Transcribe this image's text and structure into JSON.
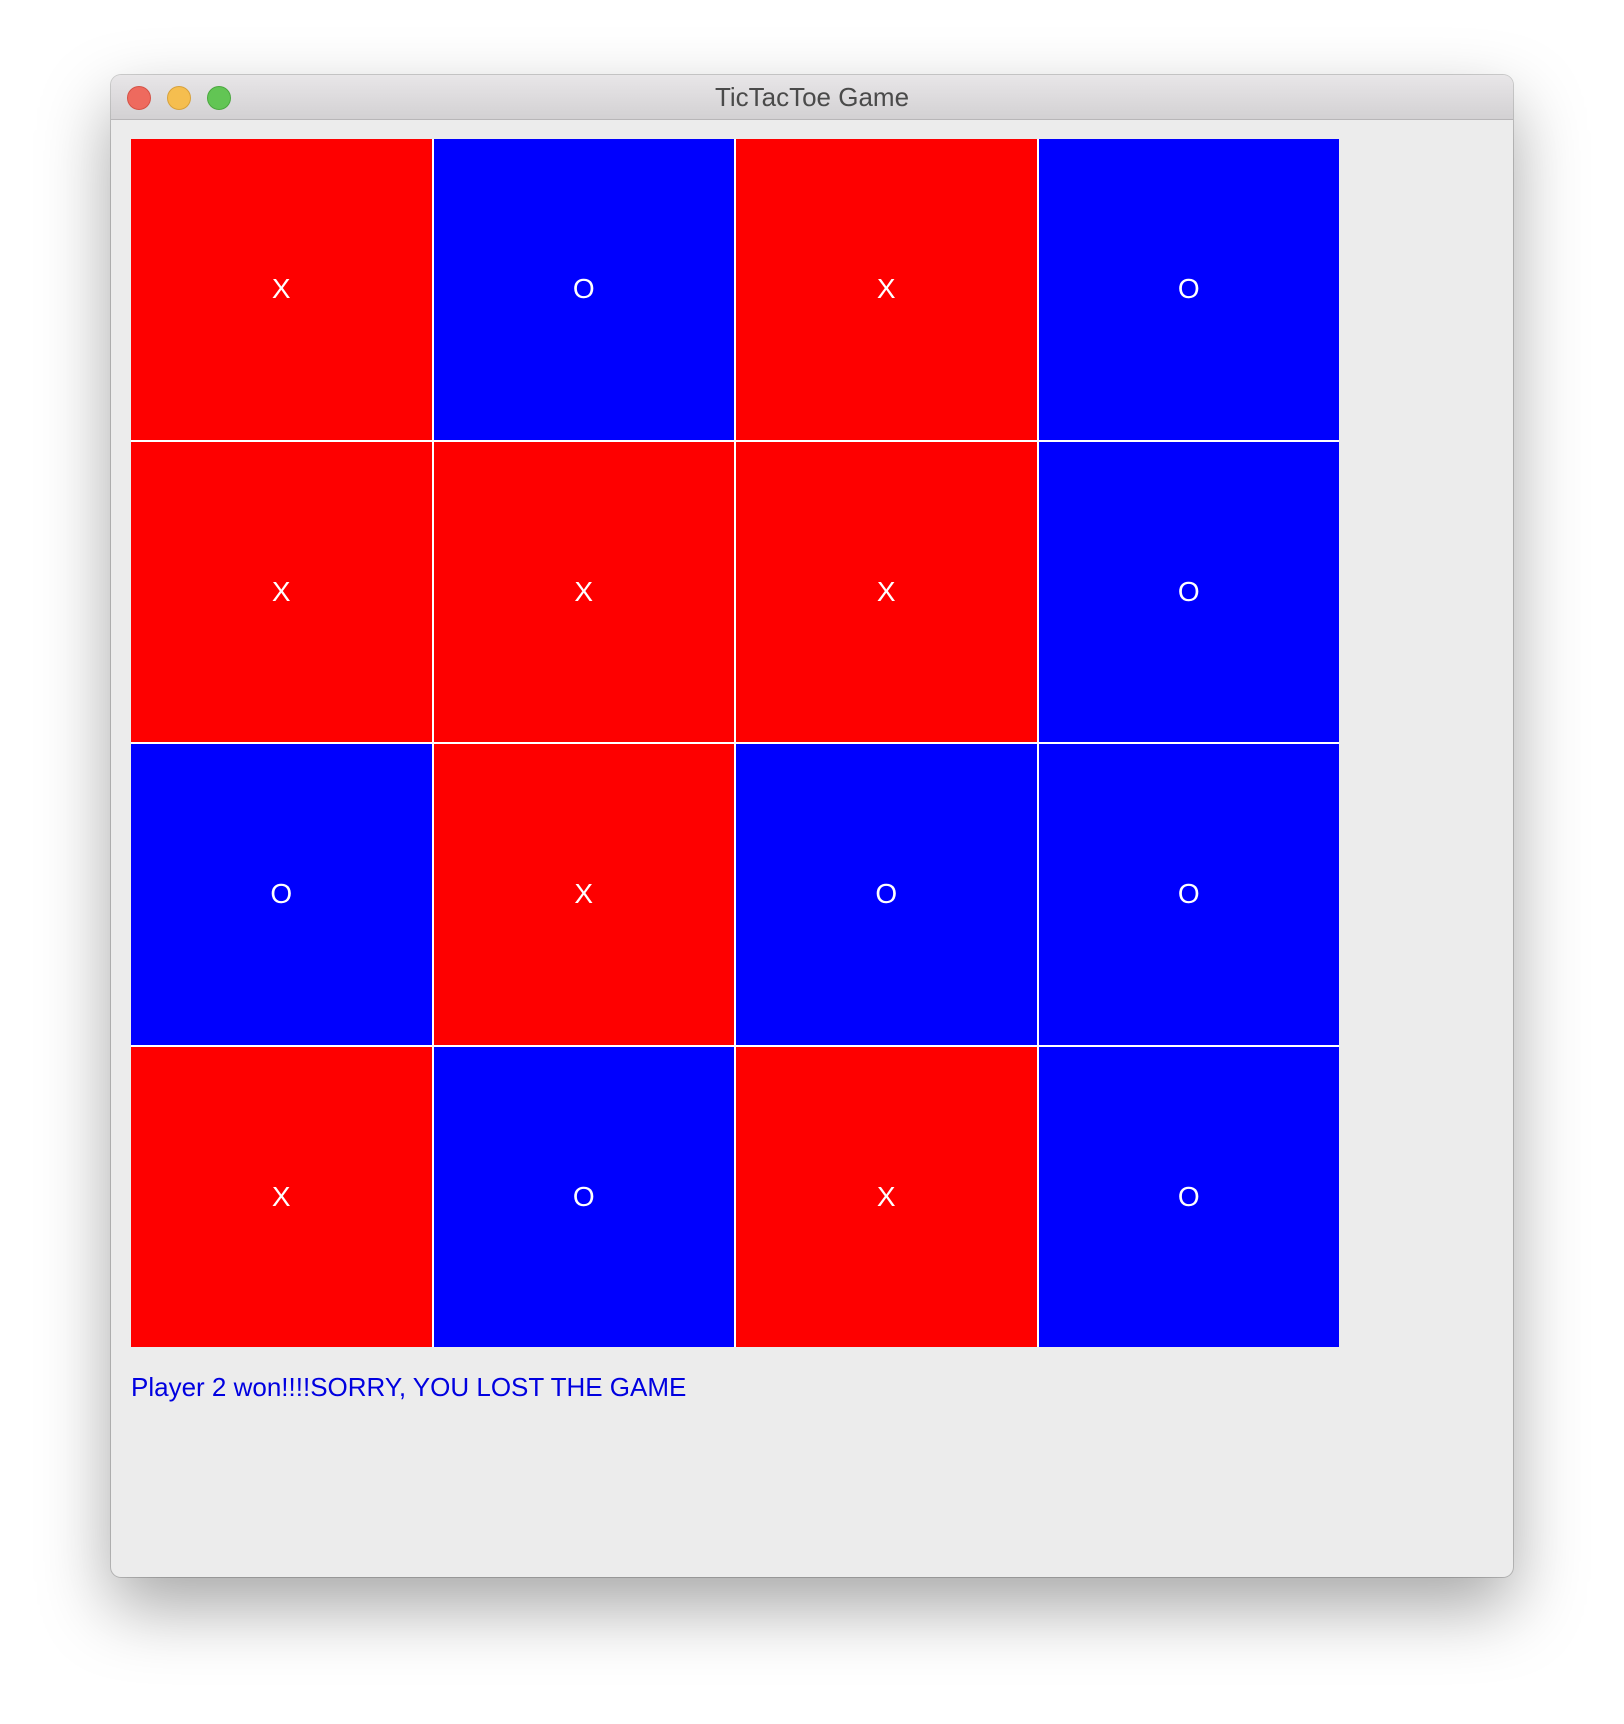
{
  "window": {
    "title": "TicTacToe Game"
  },
  "colors": {
    "X": "#fe0000",
    "O": "#0000fe",
    "status_text": "#0000e0"
  },
  "board": [
    [
      "X",
      "O",
      "X",
      "O"
    ],
    [
      "X",
      "X",
      "X",
      "O"
    ],
    [
      "O",
      "X",
      "O",
      "O"
    ],
    [
      "X",
      "O",
      "X",
      "O"
    ]
  ],
  "status": "Player 2 won!!!!SORRY, YOU LOST THE GAME"
}
